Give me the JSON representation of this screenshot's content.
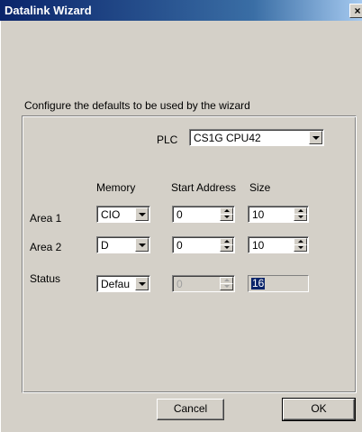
{
  "window": {
    "title": "Datalink Wizard",
    "close_glyph": "×"
  },
  "intro_text": "Configure the defaults to be used by the wizard",
  "plc": {
    "label": "PLC",
    "value": "CS1G CPU42"
  },
  "columns": {
    "memory": "Memory",
    "start_address": "Start Address",
    "size": "Size"
  },
  "rows": [
    {
      "label": "Area 1",
      "memory": "CIO",
      "start_address": "0",
      "size": "10"
    },
    {
      "label": "Area 2",
      "memory": "D",
      "start_address": "0",
      "size": "10"
    },
    {
      "label": "Status",
      "memory": "Defau",
      "start_address": "0",
      "size": "16"
    }
  ],
  "buttons": {
    "cancel": "Cancel",
    "ok": "OK"
  }
}
